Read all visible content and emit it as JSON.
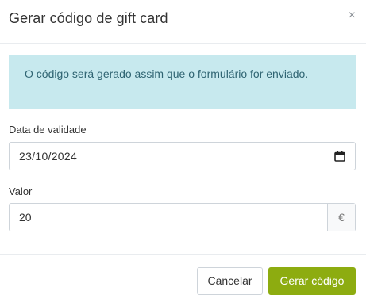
{
  "dialog": {
    "title": "Gerar código de gift card",
    "close_label": "×"
  },
  "alert": {
    "message": "O código será gerado assim que o formulário for enviado."
  },
  "form": {
    "expiry_label": "Data de validade",
    "expiry_value": "23/10/2024",
    "amount_label": "Valor",
    "amount_value": "20",
    "currency_symbol": "€"
  },
  "footer": {
    "cancel_label": "Cancelar",
    "submit_label": "Gerar código"
  },
  "icons": {
    "calendar": "calendar-icon",
    "close": "close-icon"
  },
  "colors": {
    "alert_bg": "#c7e9ee",
    "alert_text": "#2f6472",
    "primary": "#8dac10"
  }
}
